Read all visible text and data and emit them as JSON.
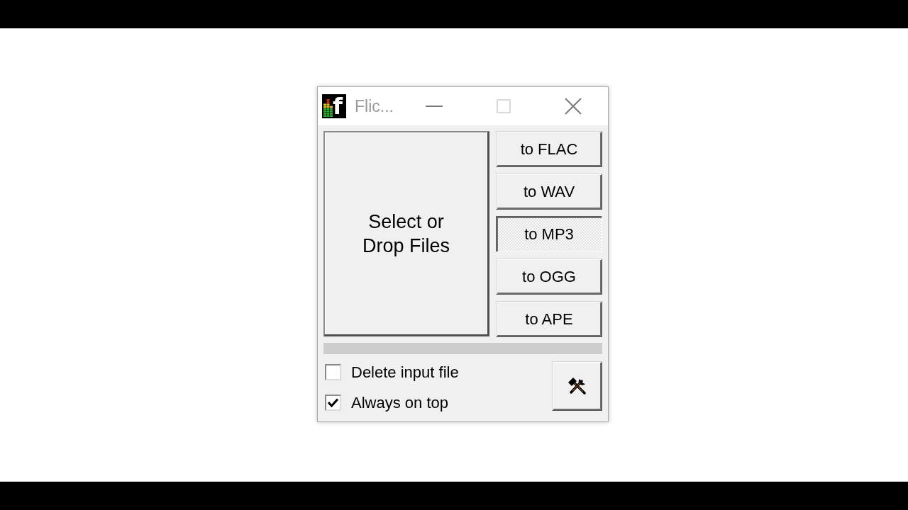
{
  "window": {
    "title": "Flic...",
    "icon_letter": "f",
    "active": false,
    "caption_buttons": [
      {
        "kind": "minimize",
        "disabled": false
      },
      {
        "kind": "maximize",
        "disabled": true
      },
      {
        "kind": "close",
        "disabled": false
      }
    ]
  },
  "drop_area": {
    "label_lines": [
      "Select or",
      "Drop Files"
    ]
  },
  "convert_buttons": [
    {
      "label": "to FLAC",
      "selected": false
    },
    {
      "label": "to WAV",
      "selected": false
    },
    {
      "label": "to MP3",
      "selected": true
    },
    {
      "label": "to OGG",
      "selected": false
    },
    {
      "label": "to APE",
      "selected": false
    }
  ],
  "progress": {
    "level": 0
  },
  "options": [
    {
      "label": "Delete input file",
      "checked": false
    },
    {
      "label": "Always on top",
      "checked": true
    }
  ]
}
